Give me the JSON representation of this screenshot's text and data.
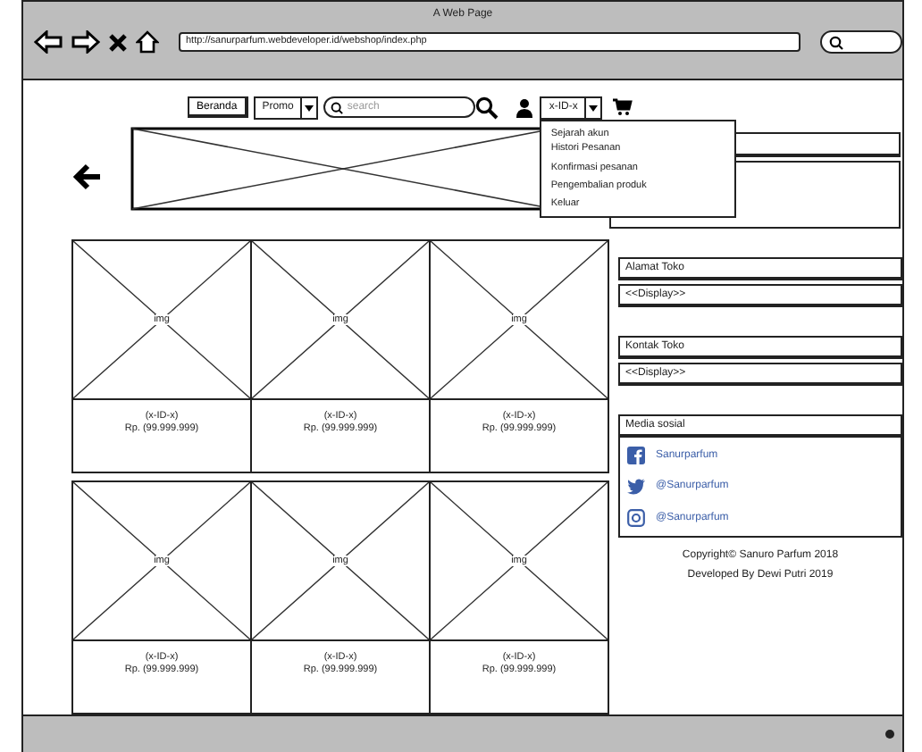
{
  "window": {
    "title": "A Web Page"
  },
  "toolbar": {
    "url": "http://sanurparfum.webdeveloper.id/webshop/index.php"
  },
  "nav": {
    "home_button": "Beranda",
    "promo": "Promo",
    "search_placeholder": "search",
    "account": "x-ID-x"
  },
  "account_menu": {
    "items": [
      "Sejarah akun",
      "Histori Pesanan",
      "Konfirmasi pesanan",
      "Pengembalian produk",
      "Keluar"
    ]
  },
  "products": [
    {
      "image_label": "img",
      "name": "(x-ID-x)",
      "price": "Rp. (99.999.999)"
    },
    {
      "image_label": "img",
      "name": "(x-ID-x)",
      "price": "Rp. (99.999.999)"
    },
    {
      "image_label": "img",
      "name": "(x-ID-x)",
      "price": "Rp. (99.999.999)"
    },
    {
      "image_label": "img",
      "name": "(x-ID-x)",
      "price": "Rp. (99.999.999)"
    },
    {
      "image_label": "img",
      "name": "(x-ID-x)",
      "price": "Rp. (99.999.999)"
    },
    {
      "image_label": "img",
      "name": "(x-ID-x)",
      "price": "Rp. (99.999.999)"
    }
  ],
  "sidebar": {
    "sections": [
      {
        "title": "Alamat Toko",
        "value": "<<Display>>"
      },
      {
        "title": "Kontak Toko",
        "value": "<<Display>>"
      }
    ],
    "social": {
      "title": "Media sosial",
      "links": [
        {
          "kind": "facebook",
          "label": "Sanurparfum"
        },
        {
          "kind": "twitter",
          "label": "@Sanurparfum"
        },
        {
          "kind": "instagram",
          "label": "@Sanurparfum"
        }
      ]
    },
    "footer": [
      "Copyright© Sanuro Parfum 2018",
      "Developed By Dewi Putri 2019"
    ]
  }
}
